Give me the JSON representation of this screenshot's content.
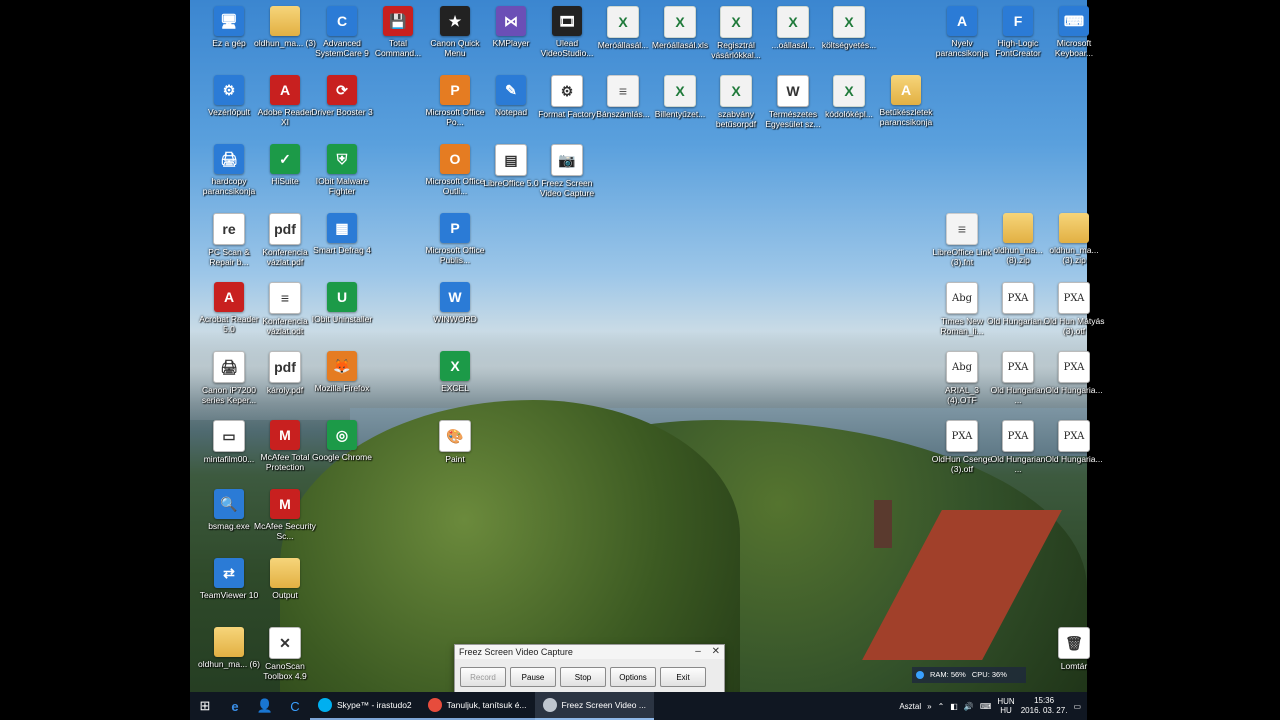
{
  "desktop": {
    "icons": [
      {
        "label": "Ez a gép",
        "icon": "computer-icon",
        "cls": "c-blue",
        "glyph": "🖥"
      },
      {
        "label": "oldhun_ma... (3)",
        "icon": "folder-icon",
        "cls": "c-folder",
        "glyph": ""
      },
      {
        "label": "Advanced SystemCare 9",
        "icon": "systemcare-icon",
        "cls": "c-blue",
        "glyph": "C"
      },
      {
        "label": "Total Command...",
        "icon": "floppy-icon",
        "cls": "c-red",
        "glyph": "💾"
      },
      {
        "label": "Canon Quick Menu",
        "icon": "canon-menu-icon",
        "cls": "c-dark",
        "glyph": "★"
      },
      {
        "label": "KMPlayer",
        "icon": "kmplayer-icon",
        "cls": "c-purple",
        "glyph": "⋈"
      },
      {
        "label": "Ulead VideoStudio...",
        "icon": "ulead-icon",
        "cls": "c-dark",
        "glyph": "🎞"
      },
      {
        "label": "Meróállasál...",
        "icon": "excel-file-icon",
        "cls": "c-xls",
        "glyph": "X"
      },
      {
        "label": "Meróállasál.xls",
        "icon": "excel-file-icon",
        "cls": "c-xls",
        "glyph": "X"
      },
      {
        "label": "Regisztrál vásárlókkal...",
        "icon": "excel-file-icon",
        "cls": "c-xls",
        "glyph": "X"
      },
      {
        "label": "...oállasál...",
        "icon": "excel-file-icon",
        "cls": "c-xls",
        "glyph": "X"
      },
      {
        "label": "költségvetés...",
        "icon": "excel-file-icon",
        "cls": "c-xls",
        "glyph": "X"
      },
      {
        "label": "Nyelv parancsikonja",
        "icon": "language-icon",
        "cls": "c-blue",
        "glyph": "A"
      },
      {
        "label": "High-Logic FontCreator",
        "icon": "fontcreator-icon",
        "cls": "c-blue",
        "glyph": "F"
      },
      {
        "label": "Microsoft Keyboar...",
        "icon": "keyboard-layout-icon",
        "cls": "c-blue",
        "glyph": "⌨"
      },
      {
        "label": "Vezérlőpult",
        "icon": "control-panel-icon",
        "cls": "c-blue",
        "glyph": "⚙"
      },
      {
        "label": "Adobe Reader XI",
        "icon": "adobe-reader-icon",
        "cls": "c-red",
        "glyph": "A"
      },
      {
        "label": "Driver Booster 3",
        "icon": "driver-booster-icon",
        "cls": "c-red",
        "glyph": "⟳"
      },
      {
        "label": "Microsoft Office Po...",
        "icon": "powerpoint-icon",
        "cls": "c-orange",
        "glyph": "P"
      },
      {
        "label": "Notepad",
        "icon": "notepad-icon",
        "cls": "c-blue",
        "glyph": "✎"
      },
      {
        "label": "Format Factory",
        "icon": "format-factory-icon",
        "cls": "c-white",
        "glyph": "⚙"
      },
      {
        "label": "Bánszámlás...",
        "icon": "document-icon",
        "cls": "c-doc",
        "glyph": "≡"
      },
      {
        "label": "Billentyűzet...",
        "icon": "excel-file-icon",
        "cls": "c-xls",
        "glyph": "X"
      },
      {
        "label": "szabvány betűsorpdf",
        "icon": "excel-file-icon",
        "cls": "c-xls",
        "glyph": "X"
      },
      {
        "label": "Természetes Egyesület sz...",
        "icon": "word-file-icon",
        "cls": "c-white",
        "glyph": "W"
      },
      {
        "label": "kódolóképl...",
        "icon": "excel-file-icon",
        "cls": "c-xls",
        "glyph": "X"
      },
      {
        "label": "Betűkészletek parancsikonja",
        "icon": "fonts-folder-icon",
        "cls": "c-folder",
        "glyph": "A"
      },
      {
        "label": "hardcopy parancsikonja",
        "icon": "hardcopy-icon",
        "cls": "c-blue",
        "glyph": "🖨"
      },
      {
        "label": "HiSuite",
        "icon": "hisuite-icon",
        "cls": "c-green",
        "glyph": "✓"
      },
      {
        "label": "IObit Malware Fighter",
        "icon": "malware-fighter-icon",
        "cls": "c-green",
        "glyph": "⛨"
      },
      {
        "label": "Microsoft Office Outli...",
        "icon": "outlook-icon",
        "cls": "c-orange",
        "glyph": "O"
      },
      {
        "label": "LibreOffice 5.0",
        "icon": "libreoffice-icon",
        "cls": "c-white",
        "glyph": "▤"
      },
      {
        "label": "Freez Screen Video Capture",
        "icon": "camera-icon",
        "cls": "c-white",
        "glyph": "📷"
      },
      {
        "label": "PC Scan & Repair b...",
        "icon": "pc-scan-icon",
        "cls": "c-white",
        "glyph": "re"
      },
      {
        "label": "Konferencia vázlat.pdf",
        "icon": "pdf-icon",
        "cls": "c-white",
        "glyph": "pdf"
      },
      {
        "label": "Smart Defrag 4",
        "icon": "smart-defrag-icon",
        "cls": "c-blue",
        "glyph": "▦"
      },
      {
        "label": "Microsoft Office Publis...",
        "icon": "publisher-icon",
        "cls": "c-blue",
        "glyph": "P"
      },
      {
        "label": "LibreOffice Link (3).fnt",
        "icon": "text-file-icon",
        "cls": "c-doc",
        "glyph": "≡"
      },
      {
        "label": "oldhun_ma... (8).zip",
        "icon": "zip-folder-icon",
        "cls": "c-folder",
        "glyph": ""
      },
      {
        "label": "oldhun_ma... (3).zip",
        "icon": "zip-folder-icon",
        "cls": "c-folder",
        "glyph": ""
      },
      {
        "label": "Acrobat Reader 5.0",
        "icon": "acrobat-icon",
        "cls": "c-red",
        "glyph": "A"
      },
      {
        "label": "Konferencia vázlat.odt",
        "icon": "odt-icon",
        "cls": "c-white",
        "glyph": "≡"
      },
      {
        "label": "IObit Uninstaller",
        "icon": "uninstaller-icon",
        "cls": "c-green",
        "glyph": "U"
      },
      {
        "label": "WINWORD",
        "icon": "word-icon",
        "cls": "c-blue",
        "glyph": "W"
      },
      {
        "label": "Times New Roman_li...",
        "icon": "font-file-icon",
        "cls": "c-font",
        "glyph": "Abg"
      },
      {
        "label": "Old Hungarian...",
        "icon": "font-file-icon",
        "cls": "c-font",
        "glyph": "PXA"
      },
      {
        "label": "Old Hun Mátyás (3).otf",
        "icon": "font-file-icon",
        "cls": "c-font",
        "glyph": "PXA"
      },
      {
        "label": "Canon iP7200 series Keper...",
        "icon": "printer-icon",
        "cls": "c-white",
        "glyph": "🖨"
      },
      {
        "label": "károly.pdf",
        "icon": "pdf-icon",
        "cls": "c-white",
        "glyph": "pdf"
      },
      {
        "label": "Mozilla Firefox",
        "icon": "firefox-icon",
        "cls": "c-orange",
        "glyph": "🦊"
      },
      {
        "label": "EXCEL",
        "icon": "excel-icon",
        "cls": "c-green",
        "glyph": "X"
      },
      {
        "label": "ARIAL_3 (4).OTF",
        "icon": "font-file-icon",
        "cls": "c-font",
        "glyph": "Abg"
      },
      {
        "label": "Old Hungarian ...",
        "icon": "font-file-icon",
        "cls": "c-font",
        "glyph": "PXA"
      },
      {
        "label": "Old Hungaria...",
        "icon": "font-file-icon",
        "cls": "c-font",
        "glyph": "PXA"
      },
      {
        "label": "mintafilm00...",
        "icon": "video-file-icon",
        "cls": "c-white",
        "glyph": "▭"
      },
      {
        "label": "McAfee Total Protection",
        "icon": "mcafee-icon",
        "cls": "c-red",
        "glyph": "M"
      },
      {
        "label": "Google Chrome",
        "icon": "chrome-icon",
        "cls": "c-green",
        "glyph": "◎"
      },
      {
        "label": "Paint",
        "icon": "paint-icon",
        "cls": "c-white",
        "glyph": "🎨"
      },
      {
        "label": "OldHun Csenge (3).otf",
        "icon": "font-file-icon",
        "cls": "c-font",
        "glyph": "PXA"
      },
      {
        "label": "Old Hungarian ...",
        "icon": "font-file-icon",
        "cls": "c-font",
        "glyph": "PXA"
      },
      {
        "label": "Old Hungaria...",
        "icon": "font-file-icon",
        "cls": "c-font",
        "glyph": "PXA"
      },
      {
        "label": "bsmag.exe",
        "icon": "magnifier-icon",
        "cls": "c-blue",
        "glyph": "🔍"
      },
      {
        "label": "McAfee Security Sc...",
        "icon": "mcafee-icon",
        "cls": "c-red",
        "glyph": "M"
      },
      {
        "label": "TeamViewer 10",
        "icon": "teamviewer-icon",
        "cls": "c-blue",
        "glyph": "⇄"
      },
      {
        "label": "Output",
        "icon": "folder-icon",
        "cls": "c-folder",
        "glyph": ""
      },
      {
        "label": "oldhun_ma... (6)",
        "icon": "folder-icon",
        "cls": "c-folder",
        "glyph": ""
      },
      {
        "label": "CanoScan Toolbox 4.9",
        "icon": "canoscan-icon",
        "cls": "c-white",
        "glyph": "✕"
      },
      {
        "label": "Lomtár",
        "icon": "recycle-bin-icon",
        "cls": "c-white",
        "glyph": "🗑"
      }
    ]
  },
  "capture_window": {
    "title": "Freez Screen Video Capture",
    "record": "Record",
    "pause": "Pause",
    "stop": "Stop",
    "options": "Options",
    "exit": "Exit"
  },
  "monitor": {
    "ram": "RAM: 56%",
    "cpu": "CPU: 36%"
  },
  "taskbar": {
    "apps": [
      {
        "label": "Skype™ - irastudo2",
        "icon": "skype-icon",
        "color": "#00aff0",
        "state": "open"
      },
      {
        "label": "Tanuljuk, tanítsuk é...",
        "icon": "chrome-icon",
        "color": "#e74c3c",
        "state": "open"
      },
      {
        "label": "Freez Screen Video ...",
        "icon": "camera-icon",
        "color": "#bfc6cf",
        "state": "active"
      }
    ],
    "desktop_label": "Asztal",
    "lang_top": "HUN",
    "lang_bottom": "HU",
    "time": "15:36",
    "date": "2016. 03. 27."
  }
}
